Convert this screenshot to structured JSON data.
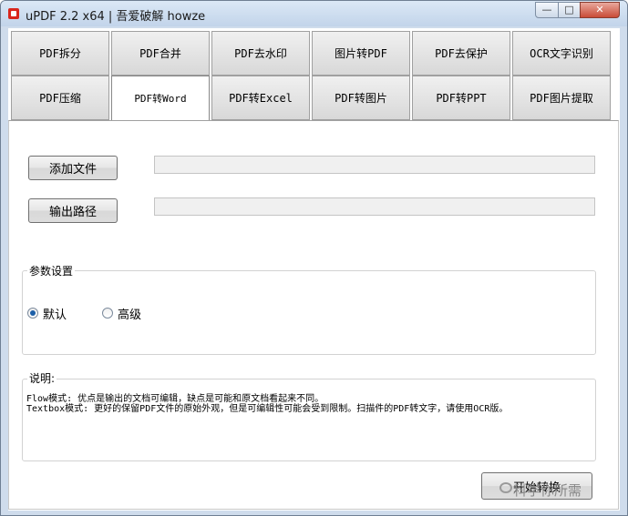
{
  "window": {
    "title": "uPDF 2.2 x64 | 吾爱破解 howze",
    "min_glyph": "—",
    "max_glyph": "□",
    "close_glyph": "✕"
  },
  "tabs_row1": [
    "PDF拆分",
    "PDF合并",
    "PDF去水印",
    "图片转PDF",
    "PDF去保护",
    "OCR文字识别"
  ],
  "tabs_row2": [
    "PDF压缩",
    "PDF转Word",
    "PDF转Excel",
    "PDF转图片",
    "PDF转PPT",
    "PDF图片提取"
  ],
  "active_tab": "PDF转Word",
  "files": {
    "add_label": "添加文件",
    "add_value": "",
    "output_label": "输出路径",
    "output_value": ""
  },
  "params": {
    "legend": "参数设置",
    "options": [
      "默认",
      "高级"
    ],
    "selected": "默认"
  },
  "notes": {
    "legend": "说明:",
    "lines": [
      "Flow模式: 优点是输出的文档可编辑，缺点是可能和原文档看起来不同。",
      "Textbox模式: 更好的保留PDF文件的原始外观，但是可编辑性可能会受到限制。扫描件的PDF转文字，请使用OCR版。"
    ]
  },
  "action": {
    "label": "开始转换"
  },
  "watermark": {
    "text": "科学你所需"
  }
}
